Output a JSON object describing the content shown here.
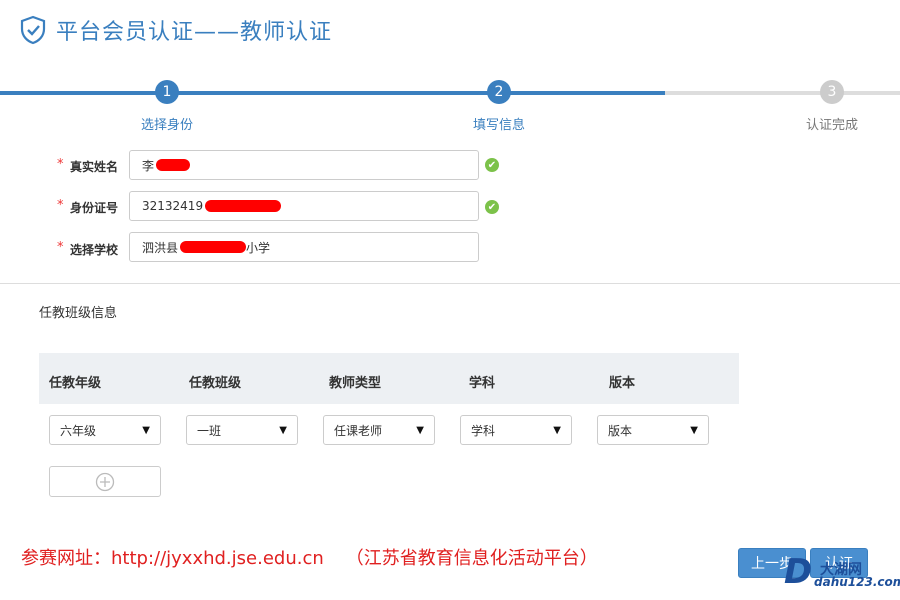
{
  "header": {
    "title": "平台会员认证——教师认证",
    "icon": "shield-check-icon",
    "accent": "#3a7fbf"
  },
  "steps": [
    {
      "num": "1",
      "label": "选择身份",
      "state": "done"
    },
    {
      "num": "2",
      "label": "填写信息",
      "state": "active"
    },
    {
      "num": "3",
      "label": "认证完成",
      "state": "pending"
    }
  ],
  "form": {
    "required_mark": "*",
    "name": {
      "label": "真实姓名",
      "value": "李"
    },
    "id_no": {
      "label": "身份证号",
      "value": "32132419"
    },
    "school": {
      "label": "选择学校",
      "value_prefix": "泗洪县",
      "value_suffix": "小学"
    }
  },
  "class_info": {
    "section_label": "任教班级信息",
    "headers": [
      "任教年级",
      "任教班级",
      "教师类型",
      "学科",
      "版本"
    ],
    "selects": [
      {
        "value": "六年级"
      },
      {
        "value": "一班"
      },
      {
        "value": "任课老师"
      },
      {
        "value": "学科"
      },
      {
        "value": "版本"
      }
    ],
    "add_icon": "plus-circle-icon"
  },
  "footer": {
    "note": "参赛网址：http://jyxxhd.jse.edu.cn",
    "platform": "（江苏省教育信息化活动平台）",
    "prev_label": "上一步",
    "submit_label": "认证"
  },
  "watermark": {
    "letter": "D",
    "cn": "大湖网",
    "url": "dahu123.com"
  }
}
